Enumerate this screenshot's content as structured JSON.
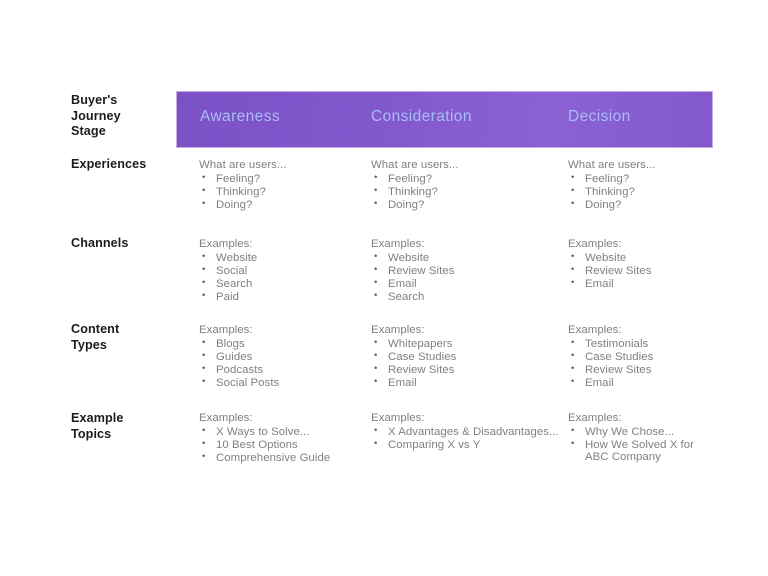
{
  "table": {
    "corner_label": "Buyer's\nJourney\nStage",
    "corner_label_lines": [
      "Buyer's",
      "Journey",
      "Stage"
    ],
    "columns": [
      {
        "label": "Awareness"
      },
      {
        "label": "Consideration"
      },
      {
        "label": "Decision"
      }
    ],
    "rows": [
      {
        "label": "Experiences",
        "label_lines": [
          "Experiences"
        ],
        "cells": [
          {
            "lead": "What are users...",
            "items": [
              "Feeling?",
              "Thinking?",
              "Doing?"
            ]
          },
          {
            "lead": "What are users...",
            "items": [
              "Feeling?",
              "Thinking?",
              "Doing?"
            ]
          },
          {
            "lead": "What are users...",
            "items": [
              "Feeling?",
              "Thinking?",
              "Doing?"
            ]
          }
        ]
      },
      {
        "label": "Channels",
        "label_lines": [
          "Channels"
        ],
        "cells": [
          {
            "lead": "Examples:",
            "items": [
              "Website",
              "Social",
              "Search",
              "Paid"
            ]
          },
          {
            "lead": "Examples:",
            "items": [
              "Website",
              "Review Sites",
              "Email",
              "Search"
            ]
          },
          {
            "lead": "Examples:",
            "items": [
              "Website",
              "Review Sites",
              "Email"
            ]
          }
        ]
      },
      {
        "label": "Content Types",
        "label_lines": [
          "Content",
          "Types"
        ],
        "cells": [
          {
            "lead": "Examples:",
            "items": [
              "Blogs",
              "Guides",
              "Podcasts",
              "Social Posts"
            ]
          },
          {
            "lead": "Examples:",
            "items": [
              "Whitepapers",
              "Case Studies",
              "Review Sites",
              "Email"
            ]
          },
          {
            "lead": "Examples:",
            "items": [
              "Testimonials",
              "Case Studies",
              "Review Sites",
              "Email"
            ]
          }
        ]
      },
      {
        "label": "Example Topics",
        "label_lines": [
          "Example",
          "Topics"
        ],
        "cells": [
          {
            "lead": "Examples:",
            "items": [
              "X Ways to Solve...",
              "10 Best Options",
              "Comprehensive Guide"
            ]
          },
          {
            "lead": "Examples:",
            "items": [
              "X Advantages & Disadvantages...",
              "Comparing X vs Y"
            ]
          },
          {
            "lead": "Examples:",
            "items": [
              "Why We Chose...",
              "How We Solved X for ABC Company"
            ]
          }
        ]
      }
    ]
  },
  "colors": {
    "header_band_start": "#7b51c6",
    "header_band_end": "#8a62d3",
    "header_band_border": "#c9a8e6",
    "header_text": "#a9bdf5",
    "row_label_text": "#1c1c1c",
    "body_text": "#7f8084",
    "bullet": "#5d5e62",
    "background": "#ffffff"
  }
}
